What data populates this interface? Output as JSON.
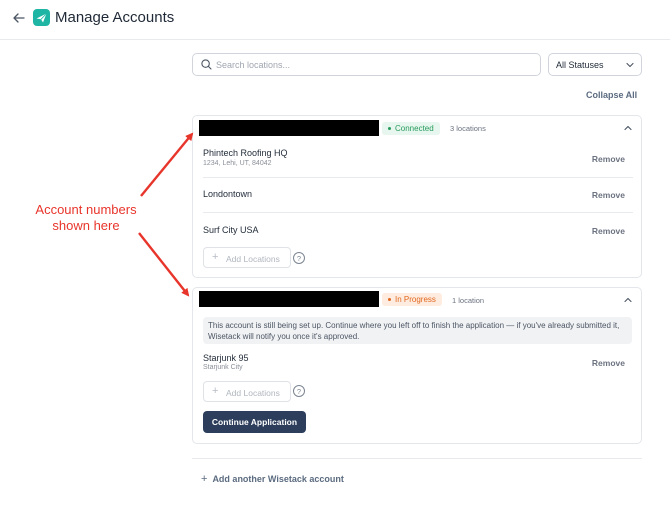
{
  "header": {
    "title": "Manage Accounts",
    "back_icon": "arrow-left-icon",
    "logo_icon": "paper-plane-icon",
    "logo_color": "#1fb5a4"
  },
  "toolbar": {
    "search_placeholder": "Search locations...",
    "status_filter": "All Statuses",
    "collapse_all": "Collapse All"
  },
  "accounts": [
    {
      "status": "Connected",
      "status_color": "#269b5c",
      "location_count": "3 locations",
      "locations": [
        {
          "name": "Phintech Roofing HQ",
          "address": "1234, Lehi, UT, 84042",
          "action": "Remove"
        },
        {
          "name": "Londontown",
          "address": "",
          "action": "Remove"
        },
        {
          "name": "Surf City USA",
          "address": "",
          "action": "Remove"
        }
      ],
      "add_locations": "Add Locations",
      "help": "?"
    },
    {
      "status": "In Progress",
      "status_color": "#e3671f",
      "location_count": "1 location",
      "notice": "This account is still being set up. Continue where you left off to finish the application — if you've already submitted it, Wisetack will notify you once it's approved.",
      "locations": [
        {
          "name": "Starjunk 95",
          "address": "Starjunk City",
          "action": "Remove"
        }
      ],
      "add_locations": "Add Locations",
      "help": "?",
      "continue_label": "Continue Application"
    }
  ],
  "add_account": "Add another Wisetack account",
  "annotation": {
    "text": "Account numbers shown here",
    "color": "#e8352b"
  }
}
